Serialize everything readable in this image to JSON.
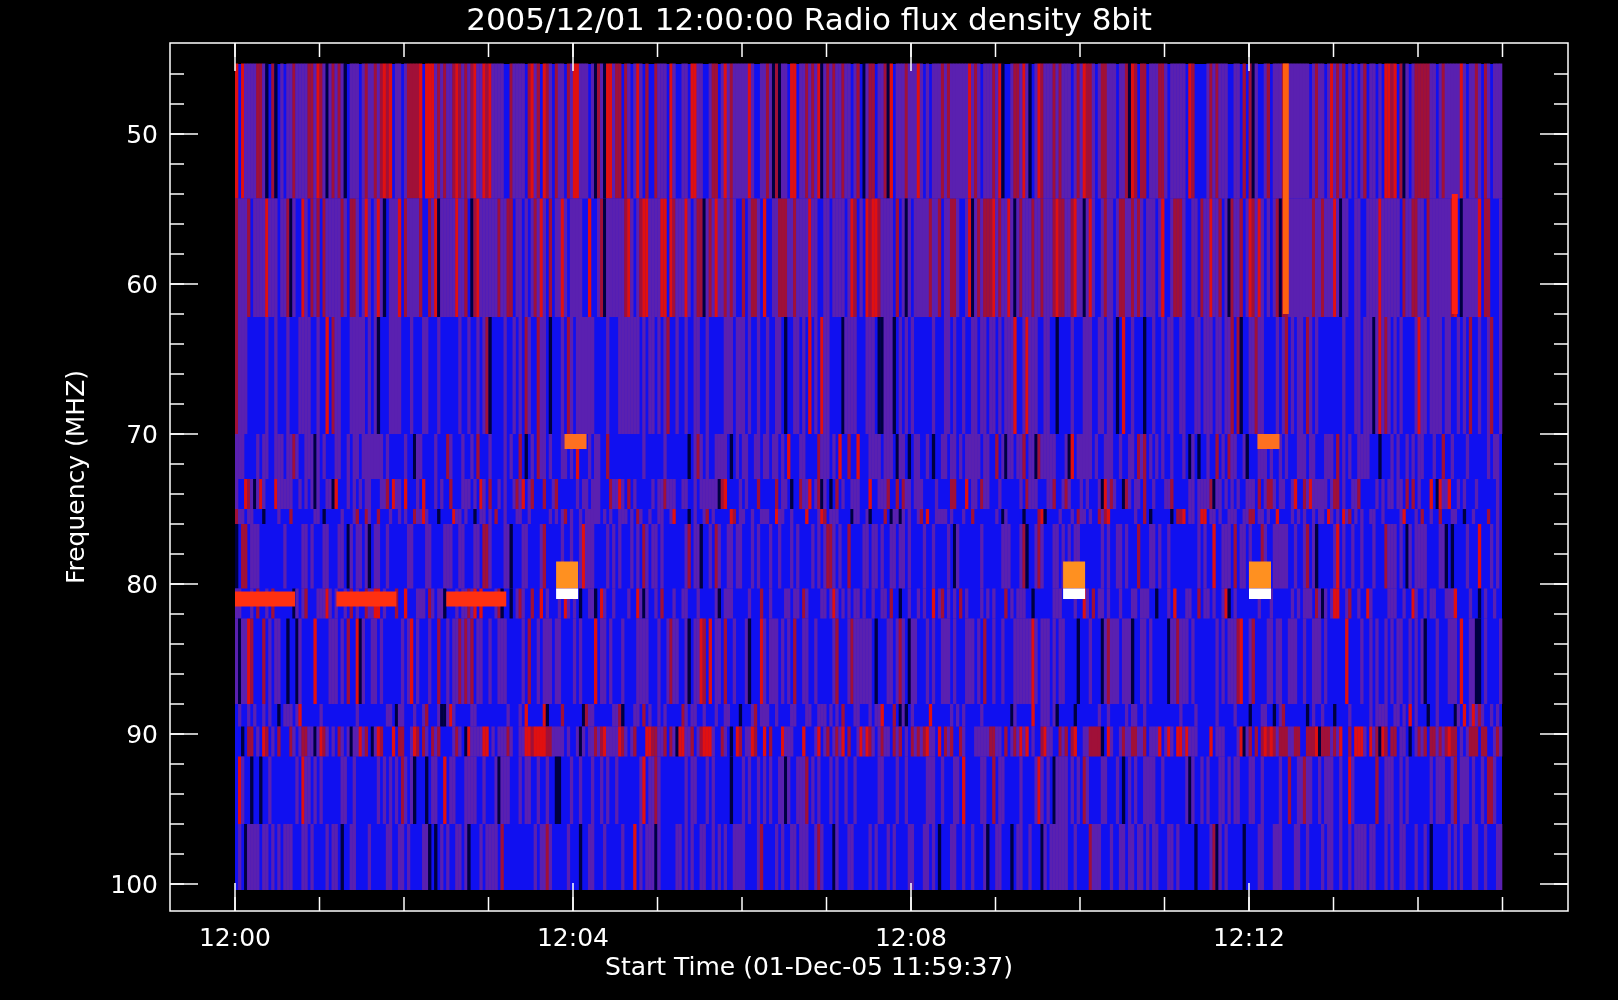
{
  "title": "2005/12/01 12:00:00 Radio flux density 8bit",
  "y_axis": {
    "title": "Frequency (MHZ)",
    "ticks": [
      "50",
      "60",
      "70",
      "80",
      "90",
      "100"
    ]
  },
  "x_axis": {
    "title": "Start Time (01-Dec-05 11:59:37)",
    "ticks": [
      "12:00",
      "12:04",
      "12:08",
      "12:12"
    ]
  }
}
